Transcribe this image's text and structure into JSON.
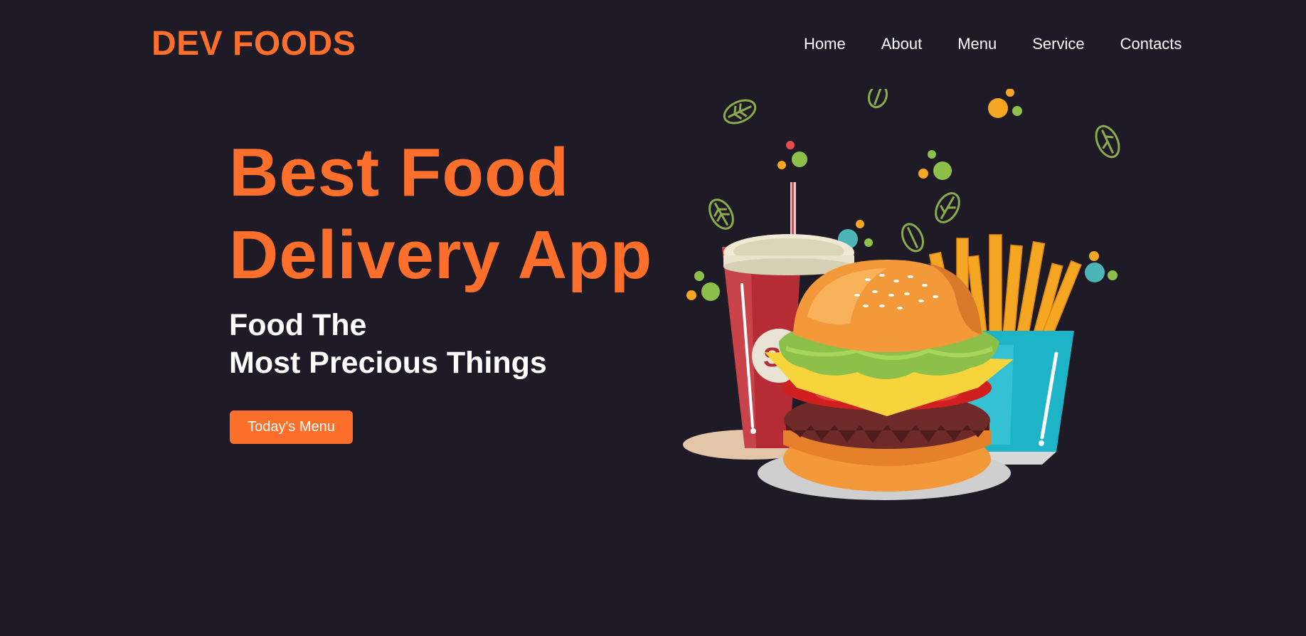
{
  "header": {
    "logo": "DEV FOODS",
    "nav": [
      "Home",
      "About",
      "Menu",
      "Service",
      "Contacts"
    ]
  },
  "hero": {
    "title_line1": "Best Food",
    "title_line2": "Delivery App",
    "subtitle_line1": "Food The",
    "subtitle_line2": "Most Precious Things",
    "button_label": "Today's Menu"
  },
  "illustration": {
    "items": [
      "soda-cup",
      "burger",
      "french-fries",
      "leaves",
      "dots"
    ]
  },
  "colors": {
    "background": "#1e1b27",
    "accent": "#ff6f2c",
    "text": "#ffffff"
  }
}
